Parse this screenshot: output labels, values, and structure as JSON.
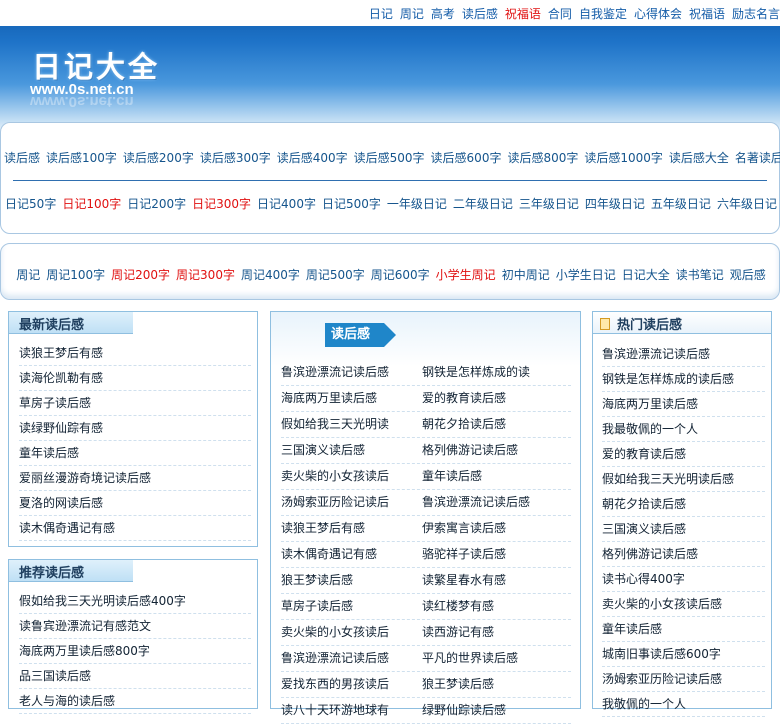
{
  "topnav": [
    {
      "label": "日记",
      "hot": false
    },
    {
      "label": "周记",
      "hot": false
    },
    {
      "label": "高考",
      "hot": false
    },
    {
      "label": "读后感",
      "hot": false
    },
    {
      "label": "祝福语",
      "hot": true
    },
    {
      "label": "合同",
      "hot": false
    },
    {
      "label": "自我鉴定",
      "hot": false
    },
    {
      "label": "心得体会",
      "hot": false
    },
    {
      "label": "祝福语",
      "hot": false
    },
    {
      "label": "励志名言",
      "hot": false
    }
  ],
  "logo": {
    "title": "日记大全",
    "url": "www.0s.net.cn"
  },
  "nav_row1": [
    "读后感",
    "读后感100字",
    "读后感200字",
    "读后感300字",
    "读后感400字",
    "读后感500字",
    "读后感600字",
    "读后感800字",
    "读后感1000字",
    "读后感大全",
    "名著读后感"
  ],
  "nav_row2": [
    {
      "label": "日记50字",
      "hot": false
    },
    {
      "label": "日记100字",
      "hot": true
    },
    {
      "label": "日记200字",
      "hot": false
    },
    {
      "label": "日记300字",
      "hot": true
    },
    {
      "label": "日记400字",
      "hot": false
    },
    {
      "label": "日记500字",
      "hot": false
    },
    {
      "label": "一年级日记",
      "hot": false
    },
    {
      "label": "二年级日记",
      "hot": false
    },
    {
      "label": "三年级日记",
      "hot": false
    },
    {
      "label": "四年级日记",
      "hot": false
    },
    {
      "label": "五年级日记",
      "hot": false
    },
    {
      "label": "六年级日记",
      "hot": false
    }
  ],
  "nav_row3": [
    {
      "label": "周记",
      "hot": false
    },
    {
      "label": "周记100字",
      "hot": false
    },
    {
      "label": "周记200字",
      "hot": true
    },
    {
      "label": "周记300字",
      "hot": true
    },
    {
      "label": "周记400字",
      "hot": false
    },
    {
      "label": "周记500字",
      "hot": false
    },
    {
      "label": "周记600字",
      "hot": false
    },
    {
      "label": "小学生周记",
      "hot": true
    },
    {
      "label": "初中周记",
      "hot": false
    },
    {
      "label": "小学生日记",
      "hot": false
    },
    {
      "label": "日记大全",
      "hot": false
    },
    {
      "label": "读书笔记",
      "hot": false
    },
    {
      "label": "观后感",
      "hot": false
    }
  ],
  "latest": {
    "title": "最新读后感",
    "items": [
      "读狼王梦后有感",
      "读海伦凯勒有感",
      "草房子读后感",
      "读绿野仙踪有感",
      "童年读后感",
      "爱丽丝漫游奇境记读后感",
      "夏洛的网读后感",
      "读木偶奇遇记有感"
    ]
  },
  "recommended": {
    "title": "推荐读后感",
    "items": [
      "假如给我三天光明读后感400字",
      "读鲁宾逊漂流记有感范文",
      "海底两万里读后感800字",
      "品三国读后感",
      "老人与海的读后感"
    ]
  },
  "middle": {
    "tag": "读后感",
    "rows": [
      [
        "鲁滨逊漂流记读后感",
        "钢铁是怎样炼成的读"
      ],
      [
        "海底两万里读后感",
        "爱的教育读后感"
      ],
      [
        "假如给我三天光明读",
        "朝花夕拾读后感"
      ],
      [
        "三国演义读后感",
        "格列佛游记读后感"
      ],
      [
        "卖火柴的小女孩读后",
        "童年读后感"
      ],
      [
        "汤姆索亚历险记读后",
        "鲁滨逊漂流记读后感"
      ],
      [
        "读狼王梦后有感",
        "伊索寓言读后感"
      ],
      [
        "读木偶奇遇记有感",
        "骆驼祥子读后感"
      ],
      [
        "狼王梦读后感",
        "读繁星春水有感"
      ],
      [
        "草房子读后感",
        "读红楼梦有感"
      ],
      [
        "卖火柴的小女孩读后",
        "读西游记有感"
      ],
      [
        "鲁滨逊漂流记读后感",
        "平凡的世界读后感"
      ],
      [
        "爱找东西的男孩读后",
        "狼王梦读后感"
      ],
      [
        "读八十天环游地球有",
        "绿野仙踪读后感"
      ]
    ]
  },
  "hot": {
    "title": "热门读后感",
    "items": [
      "鲁滨逊漂流记读后感",
      "钢铁是怎样炼成的读后感",
      "海底两万里读后感",
      "我最敬佩的一个人",
      "爱的教育读后感",
      "假如给我三天光明读后感",
      "朝花夕拾读后感",
      "三国演义读后感",
      "格列佛游记读后感",
      "读书心得400字",
      "卖火柴的小女孩读后感",
      "童年读后感",
      "城南旧事读后感600字",
      "汤姆索亚历险记读后感",
      "我敬佩的一个人"
    ]
  },
  "colors": {
    "link": "#14548c",
    "hot": "#e01010",
    "accent": "#1f86c9"
  }
}
